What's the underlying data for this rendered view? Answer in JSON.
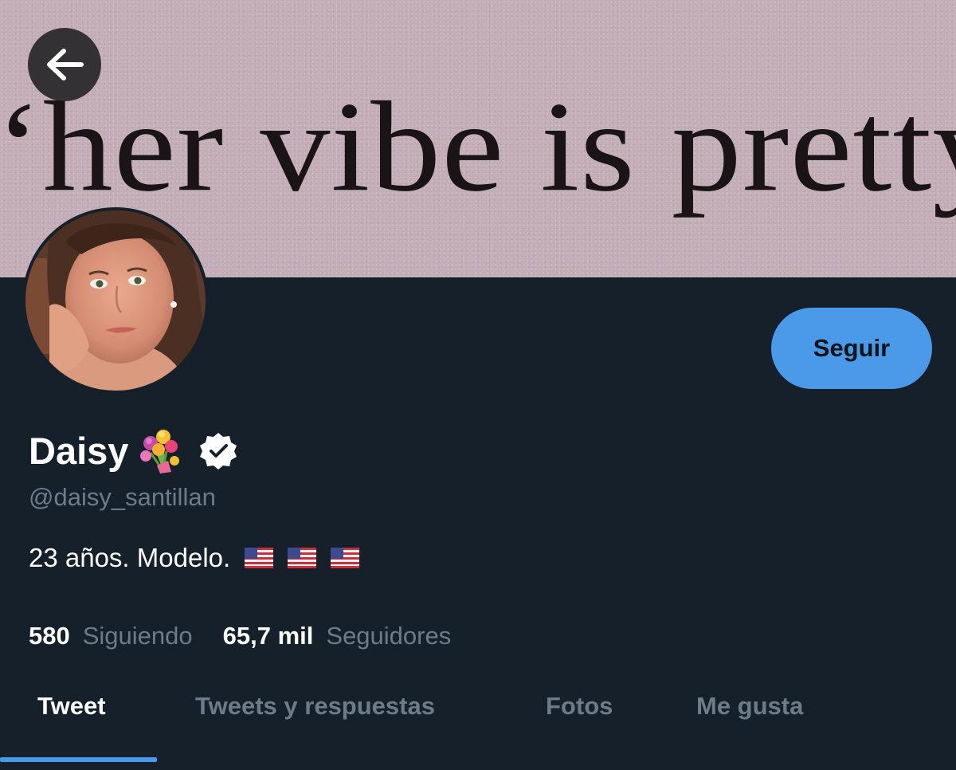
{
  "banner": {
    "text": "‘her vibe is pretty"
  },
  "header": {
    "back_icon": "arrow-left-icon"
  },
  "profile": {
    "display_name": "Daisy",
    "name_emoji": "bouquet-icon",
    "verified_icon": "verified-badge-icon",
    "handle": "@daisy_santillan",
    "bio": "23 años. Modelo.",
    "bio_emojis": [
      "us-flag-icon",
      "us-flag-icon",
      "us-flag-icon"
    ],
    "follow_label": "Seguir"
  },
  "stats": {
    "following_count": "580",
    "following_label": "Siguiendo",
    "followers_count": "65,7 mil",
    "followers_label": "Seguidores"
  },
  "tabs": [
    {
      "label": "Tweet",
      "active": true
    },
    {
      "label": "Tweets y respuestas",
      "active": false
    },
    {
      "label": "Fotos",
      "active": false
    },
    {
      "label": "Me gusta",
      "active": false
    }
  ],
  "colors": {
    "background": "#15202b",
    "accent": "#4b99e9",
    "secondary_text": "#6e7b88",
    "banner": "#c3aeb8"
  }
}
